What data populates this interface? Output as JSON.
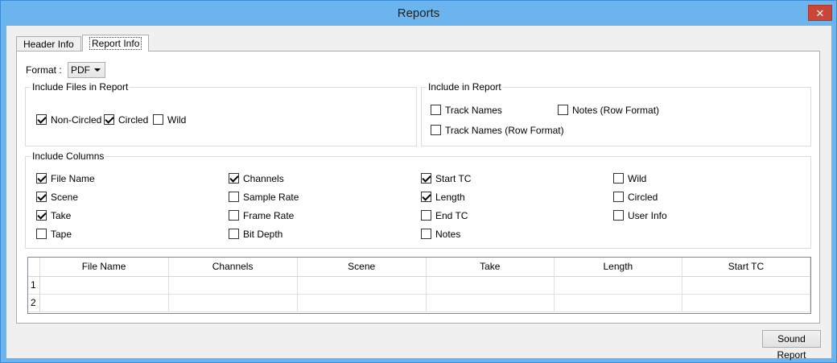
{
  "window": {
    "title": "Reports",
    "close_symbol": "✕"
  },
  "tabs": [
    {
      "label": "Header Info",
      "active": false
    },
    {
      "label": "Report Info",
      "active": true
    }
  ],
  "format": {
    "label": "Format :",
    "value": "PDF"
  },
  "include_files": {
    "title": "Include Files in Report",
    "items": [
      {
        "label": "Non-Circled",
        "checked": true
      },
      {
        "label": "Circled",
        "checked": true
      },
      {
        "label": "Wild",
        "checked": false
      }
    ]
  },
  "include_report": {
    "title": "Include in Report",
    "items": [
      {
        "label": "Track Names",
        "checked": false
      },
      {
        "label": "Notes (Row Format)",
        "checked": false
      },
      {
        "label": "Track Names (Row Format)",
        "checked": false
      }
    ]
  },
  "include_columns": {
    "title": "Include Columns",
    "items": [
      {
        "label": "File Name",
        "checked": true
      },
      {
        "label": "Scene",
        "checked": true
      },
      {
        "label": "Take",
        "checked": true
      },
      {
        "label": "Tape",
        "checked": false
      },
      {
        "label": "Channels",
        "checked": true
      },
      {
        "label": "Sample Rate",
        "checked": false
      },
      {
        "label": "Frame Rate",
        "checked": false
      },
      {
        "label": "Bit Depth",
        "checked": false
      },
      {
        "label": "Start TC",
        "checked": true
      },
      {
        "label": "Length",
        "checked": true
      },
      {
        "label": "End TC",
        "checked": false
      },
      {
        "label": "Notes",
        "checked": false
      },
      {
        "label": "Wild",
        "checked": false
      },
      {
        "label": "Circled",
        "checked": false
      },
      {
        "label": "User Info",
        "checked": false
      }
    ]
  },
  "preview_grid": {
    "columns": [
      "File Name",
      "Channels",
      "Scene",
      "Take",
      "Length",
      "Start TC"
    ],
    "rows": [
      "1",
      "2"
    ]
  },
  "sound_report_button": "Sound Report"
}
